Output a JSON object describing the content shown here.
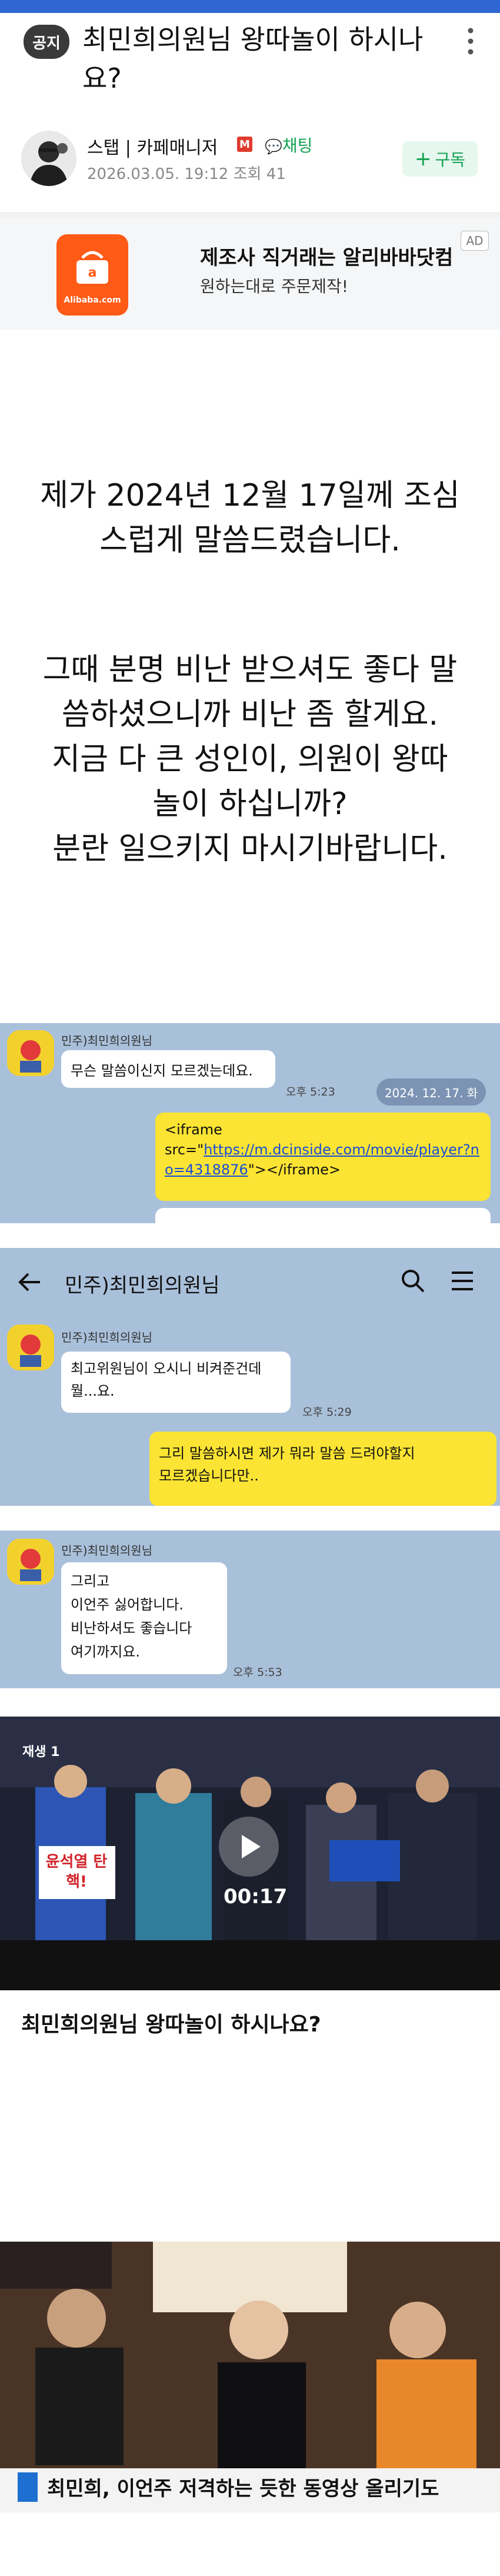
{
  "header": {
    "badge": "공지",
    "title": "최민희의원님 왕따놀이 하시나요?"
  },
  "author": {
    "name": "스탭 | 카페매니저",
    "role_badge": "M",
    "chat_label": "채팅",
    "date": "2026.03.05. 19:12",
    "views": "조회 41",
    "subscribe_label": "구독"
  },
  "ad": {
    "logo_text": "Alibaba.com",
    "title": "제조사 직거래는 알리바바닷컴",
    "subtitle": "원하는대로 주문제작!",
    "tag": "AD"
  },
  "body": {
    "para1": [
      "제가 2024년 12월 17일께 조심",
      "스럽게 말씀드렸습니다."
    ],
    "para2": [
      "그때 분명 비난 받으셔도 좋다 말",
      "씀하셨으니까 비난 좀 할게요.",
      "지금 다 큰 성인이, 의원이 왕따",
      "놀이 하십니까?",
      "분란 일으키지 마시기바랍니다."
    ]
  },
  "chat1": {
    "sender": "민주)최민희의원님",
    "msg": "무슨 말씀이신지 모르겠는데요.",
    "time": "오후 5:23",
    "date_chip": "2024. 12. 17. 화",
    "iframe_prefix": "<iframe",
    "iframe_src_label": "src=\"",
    "iframe_link": "https://m.dcinside.com/movie/player?no=4318876",
    "iframe_suffix": "\"></iframe>"
  },
  "chat2": {
    "back_icon": "arrow-left-icon",
    "title": "민주)최민희의원님",
    "sender": "민주)최민희의원님",
    "msg": [
      "최고위원님이 오시니 비켜준건데",
      "뭘...요."
    ],
    "time": "오후 5:29",
    "reply": [
      "그리 말씀하시면 제가 뭐라 말씀 드려야할지",
      "모르겠습니다만.."
    ]
  },
  "chat3": {
    "sender": "민주)최민희의원님",
    "msg": [
      "그리고",
      "이언주 싫어합니다.",
      "비난하셔도 좋습니다",
      "여기까지요."
    ],
    "time": "오후 5:53"
  },
  "video": {
    "replay_label": "재생 1",
    "duration": "00:17",
    "sign1": "윤석열 탄핵!",
    "title": "최민희의원님 왕따놀이 하시나요?"
  },
  "thumbnail": {
    "caption": "최민희, 이언주 저격하는 듯한 동영상 올리기도"
  },
  "colors": {
    "accent_green": "#12a150",
    "chat_bg": "#a9c0da",
    "bubble_yellow": "#fbe433",
    "top_bar": "#2f66d3"
  }
}
